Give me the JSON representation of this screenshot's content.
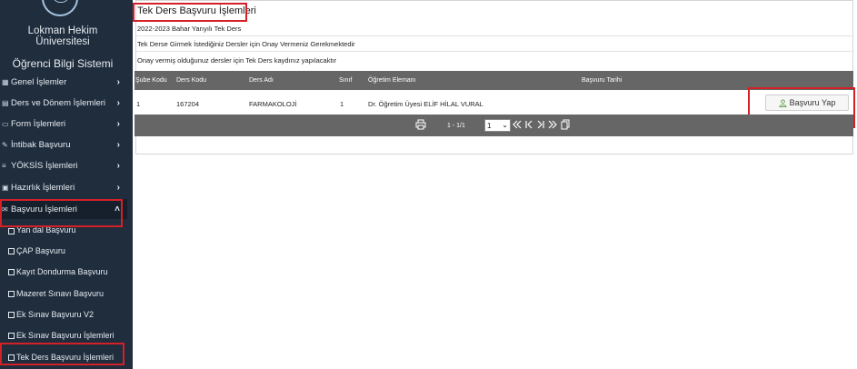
{
  "sidebar": {
    "university": "Lokman Hekim Üniversitesi",
    "system": "Öğrenci Bilgi Sistemi",
    "menu": [
      {
        "label": "Genel İşlemler",
        "icon": "grid-icon"
      },
      {
        "label": "Ders ve Dönem İşlemleri",
        "icon": "book-icon"
      },
      {
        "label": "Form İşlemleri",
        "icon": "folder-icon"
      },
      {
        "label": "İntibak Başvuru",
        "icon": "pencil-icon"
      },
      {
        "label": "YÖKSİS İşlemleri",
        "icon": "list-icon"
      },
      {
        "label": "Hazırlık İşlemleri",
        "icon": "id-card-icon"
      },
      {
        "label": "Başvuru İşlemleri",
        "icon": "inbox-icon"
      }
    ],
    "submenu": [
      {
        "label": "Yan dal Başvuru"
      },
      {
        "label": "ÇAP Başvuru"
      },
      {
        "label": "Kayıt Dondurma Başvuru"
      },
      {
        "label": "Mazeret Sınavı Başvuru"
      },
      {
        "label": "Ek Sınav Başvuru V2"
      },
      {
        "label": "Ek Sınav Başvuru İşlemleri"
      },
      {
        "label": "Tek Ders Başvuru İşlemleri"
      }
    ]
  },
  "page": {
    "title": "Tek Ders Başvuru İşlemleri",
    "term": "2022-2023 Bahar Yarıyılı Tek Ders",
    "info1": "Tek Derse Girmek İstediğiniz Dersler için Onay Vermeniz Gerekmektedir",
    "info2": "Onay vermiş olduğunuz dersler için Tek Ders kaydınız yapılacaktır"
  },
  "table": {
    "headers": [
      "Şube Kodu",
      "Ders Kodu",
      "Ders Adı",
      "Sınıf",
      "Öğretim Elemanı",
      "Başvuru Tarihi"
    ],
    "rows": [
      {
        "sube": "1",
        "kod": "167204",
        "ad": "FARMAKOLOJİ",
        "sinif": "1",
        "eleman": "Dr. Öğretim Üyesi ELİF HİLAL VURAL",
        "tarih": "",
        "action": "Başvuru Yap"
      }
    ]
  },
  "pager": {
    "range": "1 - 1/1",
    "page": "1"
  },
  "colors": {
    "sidebar": "#1f2d3d",
    "table_header": "#666666",
    "highlight_box": "#d42027"
  }
}
